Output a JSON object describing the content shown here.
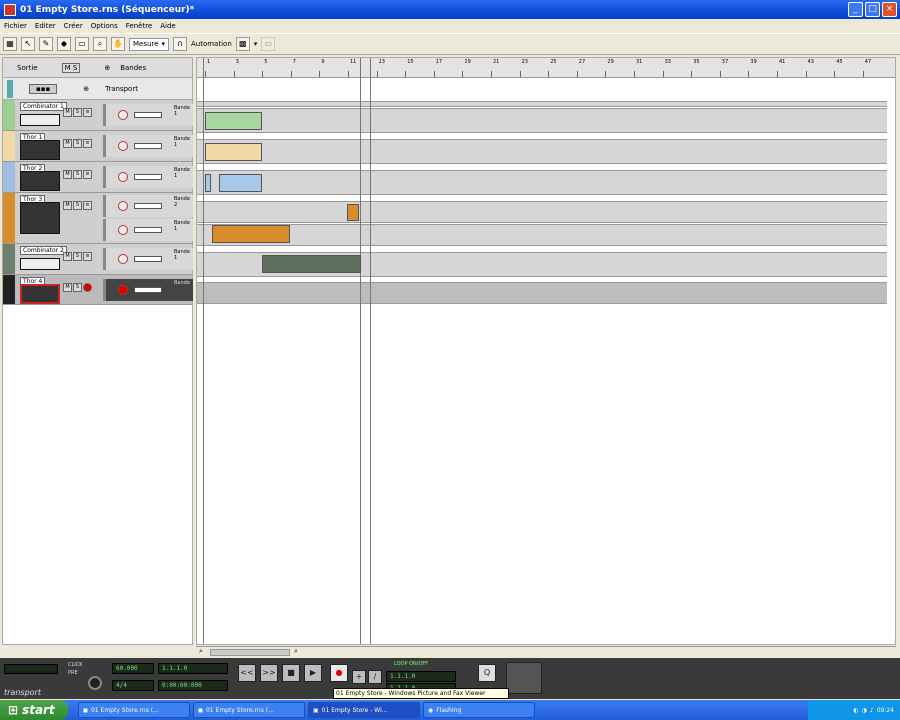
{
  "window": {
    "title": "01 Empty Store.rns (Séquenceur)*"
  },
  "menu": [
    "Fichier",
    "Editer",
    "Créer",
    "Options",
    "Fenêtre",
    "Aide"
  ],
  "toolbar": {
    "snap_value": "Mesure",
    "automation_label": "Automation"
  },
  "leftpanel": {
    "header": {
      "sortie": "Sortie",
      "ms_label": "M S",
      "bandes": "Bandes"
    },
    "transport_label": "Transport",
    "tracks": [
      {
        "name": "Combinator 1",
        "color": "#9fcf8f",
        "lanes": [
          "Bande 1"
        ]
      },
      {
        "name": "Thor 1",
        "color": "#f2d9a6",
        "lanes": [
          "Bande 1"
        ]
      },
      {
        "name": "Thor 2",
        "color": "#9fbfe0",
        "lanes": [
          "Bande 1"
        ]
      },
      {
        "name": "Thor 3",
        "color": "#d98c2b",
        "lanes": [
          "Bande 2",
          "Bande 1"
        ]
      },
      {
        "name": "Combinator 2",
        "color": "#6f7f6f",
        "lanes": [
          "Bande 1"
        ]
      },
      {
        "name": "Thor 4",
        "color": "#222222",
        "lanes": [
          "Bande"
        ]
      }
    ]
  },
  "ruler": {
    "bars": [
      "1",
      "3",
      "5",
      "7",
      "9",
      "11",
      "13",
      "15",
      "17",
      "19",
      "21",
      "23",
      "25",
      "27",
      "29",
      "31",
      "33",
      "35",
      "37",
      "39",
      "41",
      "43",
      "45",
      "47"
    ]
  },
  "transport": {
    "tempo": "60.000",
    "signature": "4/4",
    "position": "1.1.1.0",
    "time": "0:00:00:000",
    "left_loc": "1.1.1.0",
    "right_loc": "1.1.1.0",
    "label": "transport",
    "click_label": "CLICK",
    "pre_label": "PRE",
    "loop_label": "LOOP ON/OFF",
    "q_label": "Q",
    "rewind": "<<",
    "ff": ">>",
    "stop": "■",
    "play": "▶"
  },
  "tooltip": "01 Empty Store - Windows Picture and Fax Viewer",
  "taskbar": {
    "start": "start",
    "tasks": [
      "01 Empty Store.rns (...",
      "01 Empty Store.rns (...",
      "01 Empty Store - Wi...",
      "Flashing"
    ],
    "clock": "09:24"
  },
  "colors": {
    "accent": "#245edb",
    "clip_green": "#a8d8a0",
    "clip_tan": "#f0d8a8",
    "clip_blue": "#a8c8e8",
    "clip_orange": "#d98c2b",
    "clip_gray": "#5f6f5f"
  }
}
